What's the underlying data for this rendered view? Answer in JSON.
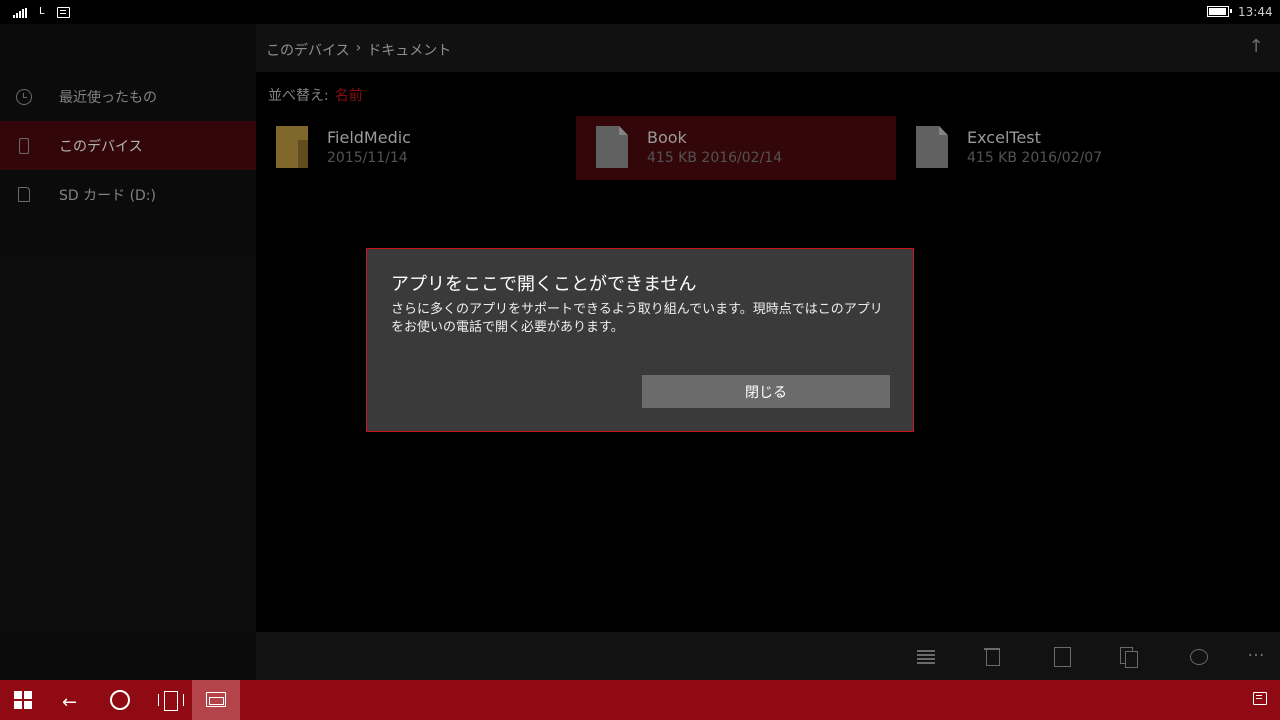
{
  "status": {
    "network_label": "L",
    "time": "13:44"
  },
  "sidebar": {
    "items": [
      {
        "label": "最近使ったもの",
        "icon": "clock-icon",
        "active": false
      },
      {
        "label": "このデバイス",
        "icon": "phone-icon",
        "active": true
      },
      {
        "label": "SD カード (D:)",
        "icon": "sd-card-icon",
        "active": false
      }
    ]
  },
  "header": {
    "breadcrumb": [
      "このデバイス",
      "›",
      "ドキュメント"
    ]
  },
  "sort": {
    "label": "並べ替え:",
    "value": "名前"
  },
  "files": [
    {
      "name": "FieldMedic",
      "meta": "2015/11/14",
      "type": "folder",
      "selected": false
    },
    {
      "name": "Book",
      "meta": "415 KB 2016/02/14",
      "type": "document",
      "selected": true
    },
    {
      "name": "ExcelTest",
      "meta": "415 KB 2016/02/07",
      "type": "document",
      "selected": false
    }
  ],
  "commandbar": {
    "more": "···"
  },
  "dialog": {
    "title": "アプリをここで開くことができません",
    "body": "さらに多くのアプリをサポートできるよう取り組んでいます。現時点ではこのアプリをお使いの電話で開く必要があります。",
    "button": "閉じる"
  },
  "colors": {
    "accent": "#c4151c",
    "taskbar": "#8f0a12",
    "selection": "#4a0a0e"
  }
}
